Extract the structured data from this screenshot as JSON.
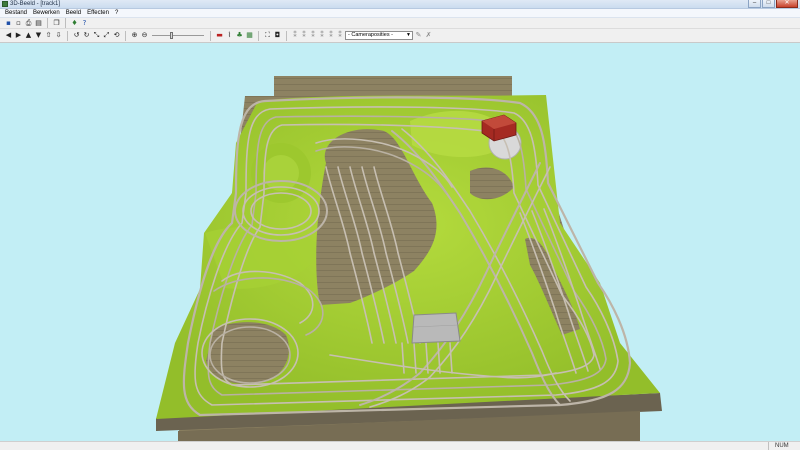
{
  "window": {
    "title": "3D-Beeld - [track1]"
  },
  "window_controls": {
    "minimize": "–",
    "maximize": "□",
    "close": "✕"
  },
  "menu": [
    "Bestand",
    "Bewerken",
    "Beeld",
    "Effecten",
    "?"
  ],
  "toolbar1": [
    {
      "name": "save-icon",
      "glyph": "▪"
    },
    {
      "name": "open-icon",
      "glyph": "▫"
    },
    {
      "name": "print-icon",
      "glyph": "⎙"
    },
    {
      "name": "preview-icon",
      "glyph": "▤"
    },
    {
      "name": "copy-icon",
      "glyph": "❐"
    },
    {
      "name": "info-icon",
      "glyph": "♦"
    },
    {
      "name": "help-icon",
      "glyph": "?"
    }
  ],
  "toolbar2": {
    "navigation": [
      {
        "name": "arrow-left-icon",
        "glyph": "◀"
      },
      {
        "name": "arrow-right-icon",
        "glyph": "▶"
      },
      {
        "name": "arrow-up-icon",
        "glyph": "▲"
      },
      {
        "name": "arrow-down-icon",
        "glyph": "▼"
      },
      {
        "name": "move-forward-icon",
        "glyph": "⇧"
      },
      {
        "name": "move-back-icon",
        "glyph": "⇩"
      }
    ],
    "rotation": [
      {
        "name": "rotate-left-icon",
        "glyph": "↺"
      },
      {
        "name": "rotate-right-icon",
        "glyph": "↻"
      },
      {
        "name": "tilt-icon",
        "glyph": "⤡"
      },
      {
        "name": "tilt-back-icon",
        "glyph": "⤢"
      },
      {
        "name": "roll-icon",
        "glyph": "⟲"
      }
    ],
    "zoom": [
      {
        "name": "zoom-in-icon",
        "glyph": "⊕"
      },
      {
        "name": "zoom-out-icon",
        "glyph": "⊖"
      }
    ],
    "view_tools": [
      {
        "name": "train-icon",
        "glyph": "▬"
      },
      {
        "name": "track-icon",
        "glyph": "⌇"
      },
      {
        "name": "tree-icon",
        "glyph": "♣"
      },
      {
        "name": "terrain-icon",
        "glyph": "▦"
      },
      {
        "name": "fullscreen-icon",
        "glyph": "⛶"
      },
      {
        "name": "camera-icon",
        "glyph": "◘"
      }
    ],
    "mode_tools": [
      {
        "name": "tool-1-icon",
        "glyph": "⁑"
      },
      {
        "name": "tool-2-icon",
        "glyph": "⁑"
      },
      {
        "name": "tool-3-icon",
        "glyph": "⁑"
      },
      {
        "name": "tool-4-icon",
        "glyph": "⁑"
      },
      {
        "name": "tool-5-icon",
        "glyph": "⁑"
      },
      {
        "name": "tool-6-icon",
        "glyph": "⁑"
      }
    ],
    "camera_select": "- Cameraposities -",
    "after_select": [
      {
        "name": "edit-camera-icon",
        "glyph": "✎"
      },
      {
        "name": "delete-camera-icon",
        "glyph": "✗"
      }
    ]
  },
  "status": {
    "num": "NUM"
  },
  "colors": {
    "sky": "#c2eef5",
    "grass": "#9dc82e",
    "board_top": "#8d8262",
    "board_front": "#6b6350",
    "track": "#c4bcb0",
    "shed": "#a52a22"
  }
}
